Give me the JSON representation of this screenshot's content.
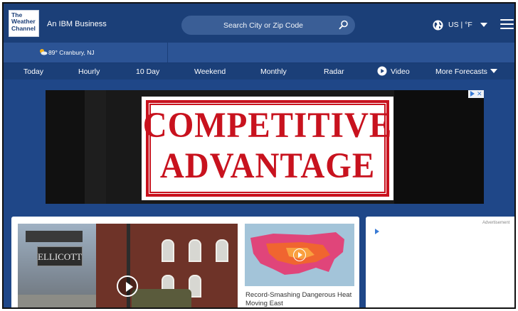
{
  "header": {
    "logo_text": "The\nWeather\nChannel",
    "ibm_label": "An IBM Business",
    "search_placeholder": "Search City or Zip Code",
    "region": "US | °F",
    "icons": [
      "search-icon",
      "globe-icon",
      "caret-down-icon",
      "hamburger-icon"
    ]
  },
  "location": {
    "temp_city": "89° Cranbury, NJ",
    "icon": "sun-cloud-icon"
  },
  "nav": {
    "items": [
      "Today",
      "Hourly",
      "10 Day",
      "Weekend",
      "Monthly",
      "Radar",
      "Video",
      "More Forecasts"
    ]
  },
  "ad": {
    "stamp_line1": "COMPETITIVE",
    "stamp_line2": "ADVANTAGE",
    "stamp_color": "#c8121e"
  },
  "content": {
    "sign_text": "ELLICOTT",
    "heat_caption": "Record-Smashing Dangerous Heat Moving East",
    "ad_label": "Advertisement"
  },
  "colors": {
    "header_bg": "#1b3f78",
    "page_bg": "#1f4788",
    "location_bar": "#2c5495"
  }
}
